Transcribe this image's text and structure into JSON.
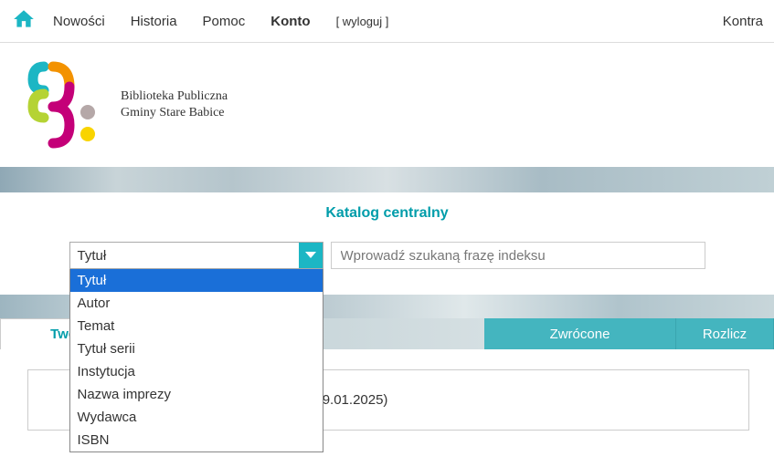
{
  "nav": {
    "items": [
      "Nowości",
      "Historia",
      "Pomoc",
      "Konto"
    ],
    "active_index": 3,
    "logout": "[ wyloguj ]",
    "kontrast": "Kontra"
  },
  "logo": {
    "line1": "Biblioteka Publiczna",
    "line2": "Gminy Stare Babice"
  },
  "catalog": {
    "title": "Katalog centralny"
  },
  "search": {
    "selected": "Tytuł",
    "options": [
      "Tytuł",
      "Autor",
      "Temat",
      "Tytuł serii",
      "Instytucja",
      "Nazwa imprezy",
      "Wydawca",
      "ISBN"
    ],
    "placeholder": "Wprowadź szukaną frazę indeksu"
  },
  "tabs": {
    "profile": "Twój profil",
    "zwrocone": "Zwrócone",
    "rozlicz": "Rozlicz"
  },
  "content": {
    "date_text": "e do 09.01.2025)"
  }
}
